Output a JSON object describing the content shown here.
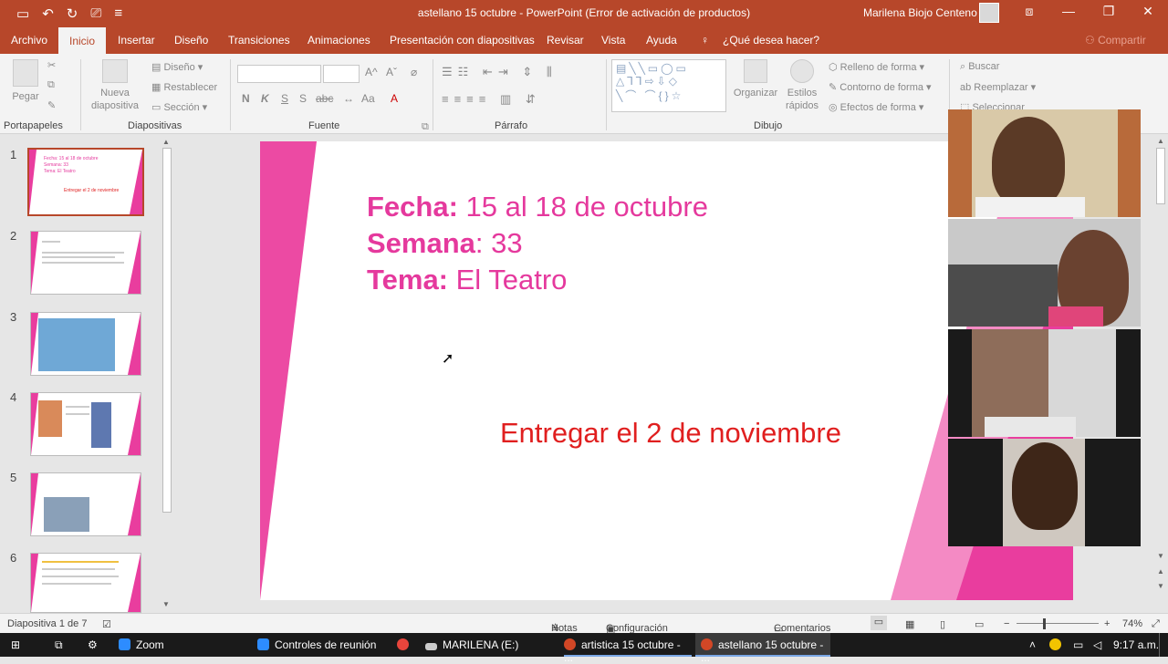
{
  "window": {
    "title": "astellano 15 octubre  -  PowerPoint (Error de activación de productos)",
    "user": "Marilena Biojo Centeno",
    "qat_icons": [
      "save-icon",
      "undo-icon",
      "redo-icon",
      "present-icon",
      "customize-icon"
    ]
  },
  "ribbon_tabs": [
    "Archivo",
    "Inicio",
    "Insertar",
    "Diseño",
    "Transiciones",
    "Animaciones",
    "Presentación con diapositivas",
    "Revisar",
    "Vista",
    "Ayuda",
    "¿Qué desea hacer?"
  ],
  "active_tab": "Inicio",
  "share_label": "Compartir",
  "ribbon": {
    "portapapeles": {
      "label": "Portapapeles",
      "pegar": "Pegar"
    },
    "diapositivas": {
      "label": "Diapositivas",
      "nueva": "Nueva",
      "nueva2": "diapositiva",
      "diseno": "Diseño",
      "restablecer": "Restablecer",
      "seccion": "Sección"
    },
    "fuente": {
      "label": "Fuente",
      "bold": "N",
      "italic": "K",
      "underline": "S",
      "strike": "S",
      "spacing": "abc",
      "case": "Aa"
    },
    "parrafo": {
      "label": "Párrafo"
    },
    "dibujo": {
      "label": "Dibujo",
      "organizar": "Organizar",
      "estilos": "Estilos",
      "estilos2": "rápidos",
      "relleno": "Relleno de forma",
      "contorno": "Contorno de forma",
      "efectos": "Efectos de forma"
    },
    "edicion": {
      "buscar": "Buscar",
      "reemplazar": "Reemplazar",
      "seleccionar": "Seleccionar"
    }
  },
  "thumbnails": [
    {
      "num": "1",
      "selected": true,
      "lines": [
        "Fecha: 15 al 18 de octubre",
        "Semana: 33",
        "Tema: El Teatro",
        "Entregar el 2 de noviembre"
      ]
    },
    {
      "num": "2",
      "selected": false
    },
    {
      "num": "3",
      "selected": false
    },
    {
      "num": "4",
      "selected": false
    },
    {
      "num": "5",
      "selected": false
    },
    {
      "num": "6",
      "selected": false
    }
  ],
  "slide": {
    "fecha_label": "Fecha:",
    "fecha_value": " 15 al 18 de octubre",
    "semana_label": "Semana",
    "semana_value": ": 33",
    "tema_label": "Tema:",
    "tema_value": " El Teatro",
    "deliver": "Entregar el 2 de noviembre",
    "colors": {
      "pink": "#e5399d",
      "red": "#e01f1f"
    }
  },
  "status": {
    "slide_counter": "Diapositiva 1 de 7",
    "notas": "Notas",
    "config": "Configuración de visualización",
    "comentarios": "Comentarios",
    "zoom": "74%"
  },
  "taskbar": {
    "items": [
      {
        "label": "Zoom",
        "icon": "zoom-icon",
        "color": "#2d8cff"
      },
      {
        "label": "Controles de reunión",
        "icon": "zoom-icon",
        "color": "#2d8cff"
      },
      {
        "label": "",
        "icon": "chrome-icon",
        "color": "#e8453c"
      },
      {
        "label": "MARILENA (E:)",
        "icon": "drive-icon",
        "color": "#cccccc"
      },
      {
        "label": "artistica 15 octubre - ...",
        "icon": "powerpoint-icon",
        "color": "#d24726"
      },
      {
        "label": "astellano 15 octubre - ...",
        "icon": "powerpoint-icon",
        "color": "#d24726"
      }
    ],
    "time": "9:17 a.m."
  }
}
